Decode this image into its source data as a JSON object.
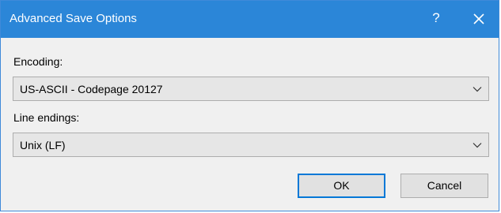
{
  "dialog": {
    "title": "Advanced Save Options",
    "help_label": "?",
    "close_icon": "close-icon",
    "colors": {
      "titlebar": "#2b86d8",
      "accent": "#0078d7"
    }
  },
  "encoding": {
    "label": "Encoding:",
    "selected": "US-ASCII - Codepage 20127",
    "icon": "chevron-down-icon"
  },
  "line_endings": {
    "label": "Line endings:",
    "selected": "Unix (LF)",
    "icon": "chevron-down-icon"
  },
  "buttons": {
    "ok_label": "OK",
    "cancel_label": "Cancel"
  }
}
